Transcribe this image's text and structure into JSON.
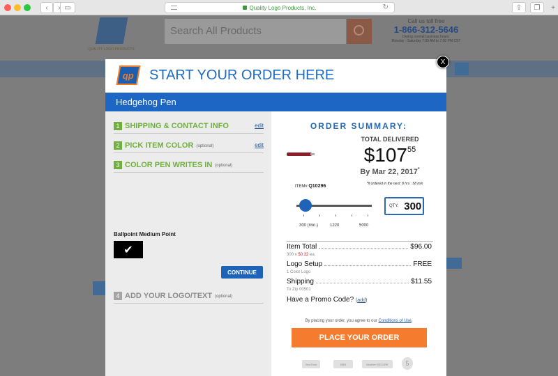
{
  "browser": {
    "url_text": "Quality Logo Products, Inc."
  },
  "background_page": {
    "search_placeholder": "Search All Products",
    "call_label": "Call us toll free",
    "phone": "1-866-312-5646",
    "hours_line1": "During normal business hours:",
    "hours_line2": "Monday - Saturday 7:00 AM to 7:00 PM CST",
    "logo_caption": "QUALITY LOGO PRODUCTS"
  },
  "modal": {
    "close_label": "X",
    "title": "START YOUR ORDER HERE",
    "product_name": "Hedgehog Pen",
    "steps": [
      {
        "num": "1",
        "label": "SHIPPING & CONTACT INFO",
        "optional": "",
        "edit": "edit"
      },
      {
        "num": "2",
        "label": "PICK ITEM COLOR",
        "optional": "(optional)",
        "edit": "edit"
      },
      {
        "num": "3",
        "label": "COLOR PEN WRITES IN",
        "optional": "(optional)",
        "edit": ""
      },
      {
        "num": "4",
        "label": "ADD YOUR LOGO/TEXT",
        "optional": "(optional)",
        "edit": ""
      }
    ],
    "ink_label": "Ballpoint Medium Point",
    "ink_check": "✔",
    "continue_label": "CONTINUE",
    "summary": {
      "title": "ORDER SUMMARY:",
      "total_label": "TOTAL DELIVERED",
      "price_dollars": "$107",
      "price_cents": "55",
      "by_date": "By Mar 22, 2017",
      "asterisk": "*",
      "item_label": "ITEM#",
      "item_no": "Q10296",
      "cutoff_note": "*If ordered in the next: 8 hrs : 58 min",
      "slider": {
        "ticks": [
          "300 (min.)",
          "1220",
          "5000"
        ],
        "position_fraction": 0.0
      },
      "qty_label": "QTY.",
      "qty_value": "300",
      "lines": [
        {
          "label": "Item Total",
          "value": "$96.00"
        },
        {
          "label": "Logo Setup",
          "value": "FREE"
        },
        {
          "label": "Shipping",
          "value": "$11.55"
        }
      ],
      "item_sub_qty": "300 x ",
      "item_sub_price": "$0.32",
      "item_sub_suffix": " ea.",
      "logo_sub": "1 Color Logo",
      "ship_sub": "To Zip 00501",
      "promo_label": "Have a Promo Code?",
      "promo_open": "(",
      "promo_add": "add",
      "promo_close": ")",
      "agree_text": "By placing your order, you agree to our ",
      "agree_link": "Conditions of Use",
      "agree_end": ".",
      "place_order": "PLACE YOUR ORDER",
      "trust_badges": [
        "GeoTrust",
        "BBB",
        "McAfee SECURE",
        "5"
      ]
    }
  },
  "colors": {
    "accent_blue": "#1d66c4",
    "step_green": "#6fb03d",
    "place_orange": "#f57c2e"
  }
}
